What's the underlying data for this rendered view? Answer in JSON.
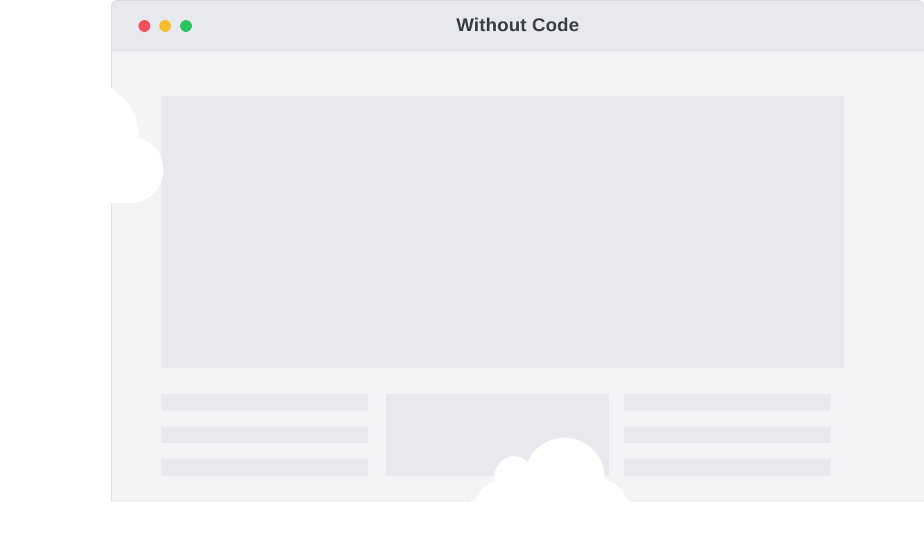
{
  "window": {
    "title": "Without Code",
    "traffic_lights": [
      {
        "name": "close",
        "color": "#f0505a"
      },
      {
        "name": "minimize",
        "color": "#f5bd2b"
      },
      {
        "name": "maximize",
        "color": "#29c45e"
      }
    ]
  },
  "colors": {
    "titlebar": "#e7e9ee",
    "content": "#f4f4f7",
    "placeholder": "#e7e9ee",
    "title_text": "#3b3f4a",
    "clouds": "#ffffff"
  },
  "decorations": {
    "left_cloud": "cloud-icon",
    "bottom_cloud": "cloud-icon"
  }
}
